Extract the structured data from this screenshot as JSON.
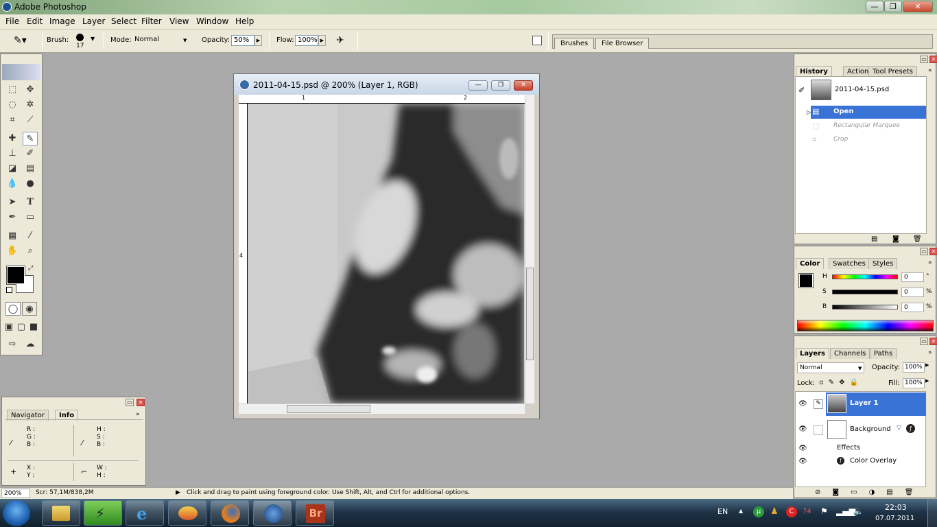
{
  "app": {
    "title": "Adobe Photoshop",
    "min": "—",
    "max": "❐",
    "close": "✕"
  },
  "menu": [
    "File",
    "Edit",
    "Image",
    "Layer",
    "Select",
    "Filter",
    "View",
    "Window",
    "Help"
  ],
  "options": {
    "brush_label": "Brush:",
    "brush_size": "17",
    "mode_label": "Mode:",
    "mode_value": "Normal",
    "opacity_label": "Opacity:",
    "opacity_value": "50%",
    "flow_label": "Flow:",
    "flow_value": "100%"
  },
  "palette_well": {
    "tabs": [
      "Brushes",
      "File Browser"
    ]
  },
  "document": {
    "title": "2011-04-15.psd @ 200% (Layer 1, RGB)",
    "ruler_h": [
      "1",
      "2"
    ],
    "ruler_v": [
      "4"
    ]
  },
  "navinfo": {
    "tabs": [
      "Navigator",
      "Info"
    ],
    "rgb": [
      "R :",
      "G :",
      "B :"
    ],
    "hsb": [
      "H :",
      "S :",
      "B :"
    ],
    "xy": [
      "X :",
      "Y :"
    ],
    "wh": [
      "W :",
      "H :"
    ]
  },
  "history": {
    "tabs": [
      "History",
      "Actions",
      "Tool Presets"
    ],
    "snapshot": "2011-04-15.psd",
    "items": [
      "Open",
      "Rectangular Marquee",
      "Crop"
    ]
  },
  "color": {
    "tabs": [
      "Color",
      "Swatches",
      "Styles"
    ],
    "channels": [
      {
        "name": "H",
        "value": "0",
        "unit": "°"
      },
      {
        "name": "S",
        "value": "0",
        "unit": "%"
      },
      {
        "name": "B",
        "value": "0",
        "unit": "%"
      }
    ]
  },
  "layers": {
    "tabs": [
      "Layers",
      "Channels",
      "Paths"
    ],
    "blend": "Normal",
    "opacity_label": "Opacity:",
    "opacity": "100%",
    "lock_label": "Lock:",
    "fill_label": "Fill:",
    "fill": "100%",
    "items": [
      "Layer 1",
      "Background"
    ],
    "effects": "Effects",
    "effect_item": "Color Overlay"
  },
  "status": {
    "zoom": "200%",
    "scratch": "Scr: 57,1M/838,2M",
    "hint": "Click and drag to paint using foreground color.  Use Shift, Alt, and Ctrl for additional options."
  },
  "taskbar": {
    "lang": "EN",
    "time": "22:03",
    "date": "07.07.2011",
    "tray_num": "74",
    "apps": [
      "explorer-icon",
      "winamp-icon",
      "ie-icon",
      "media-icon",
      "firefox-icon",
      "photoshop-icon",
      "bridge-icon"
    ],
    "bridge_label": "Br"
  }
}
